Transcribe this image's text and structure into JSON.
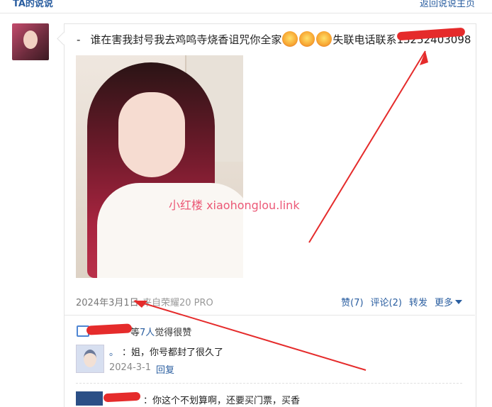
{
  "header": {
    "left_title": "TA的说说",
    "right_link": "返回说说主页"
  },
  "post": {
    "dash": "-",
    "text_before": "谁在害我封号我去鸡鸣寺烧香诅咒你全家",
    "text_after": "失联电话联系",
    "phone_tail": "13252403098",
    "watermark": "小红楼 xiaohonglou.link",
    "date": "2024年3月1日",
    "source": "来自荣耀20 PRO",
    "actions": {
      "like": "赞(7)",
      "comment": "评论(2)",
      "repost": "转发",
      "more": "更多"
    }
  },
  "likes": {
    "suffix_pre": "等",
    "count": "7人",
    "suffix": "觉得很赞"
  },
  "comments": [
    {
      "name": "。",
      "text": "：姐，你号都封了很久了",
      "date": "2024-3-1",
      "reply": "回复"
    },
    {
      "text": "：你这个不划算啊，还要买门票，买香"
    }
  ],
  "colors": {
    "link": "#2a5ea0",
    "annotation_red": "#e52b2b"
  }
}
